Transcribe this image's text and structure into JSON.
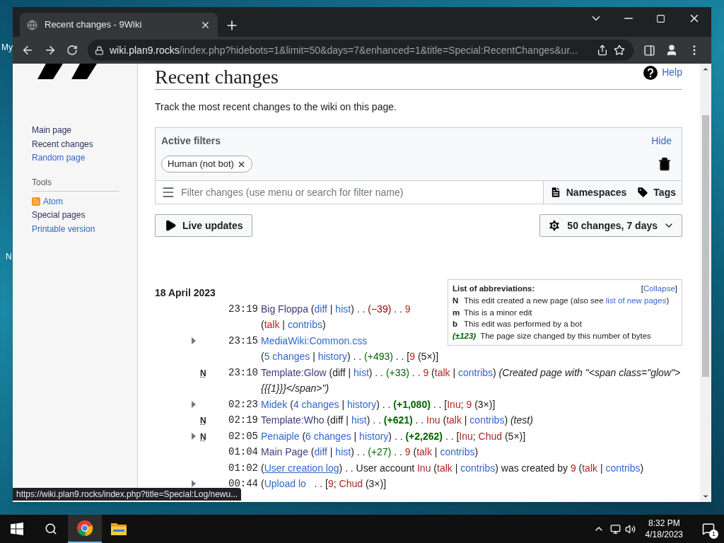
{
  "desktop": {
    "labels": [
      "My",
      "N"
    ]
  },
  "browser": {
    "tab": {
      "title": "Recent changes - 9Wiki"
    },
    "url": {
      "host": "wiki.plan9.rocks",
      "path": "/index.php?hidebots=1&limit=50&days=7&enhanced=1&title=Special:RecentChanges&ur..."
    }
  },
  "sidebar": {
    "nav": [
      {
        "label": "Main page",
        "visited": true
      },
      {
        "label": "Recent changes",
        "visited": true
      },
      {
        "label": "Random page",
        "visited": false
      }
    ],
    "tools_heading": "Tools",
    "tools": [
      {
        "label": "Atom",
        "visited": false,
        "kind": "feed"
      },
      {
        "label": "Special pages",
        "visited": true,
        "kind": "link"
      },
      {
        "label": "Printable version",
        "visited": false,
        "kind": "link"
      }
    ]
  },
  "page": {
    "title": "Recent changes",
    "help": "Help",
    "intro": "Track the most recent changes to the wiki on this page.",
    "filters": {
      "heading": "Active filters",
      "hide": "Hide",
      "tags": [
        {
          "label": "Human (not bot)"
        }
      ],
      "search_placeholder": "Filter changes (use menu or search for filter name)",
      "namespaces": "Namespaces",
      "tags_button": "Tags"
    },
    "live_updates": "Live updates",
    "options": "50 changes, 7 days"
  },
  "abbreviations": {
    "title": "List of abbreviations:",
    "collapse": {
      "open": "[",
      "label": "Collapse",
      "close": "]"
    },
    "items": [
      {
        "key": "N",
        "kind": "text",
        "parts": [
          {
            "text": "This edit created a new page (also see ",
            "kind": "text"
          },
          {
            "text": "list of new pages",
            "kind": "link"
          },
          {
            "text": ")",
            "kind": "text"
          }
        ]
      },
      {
        "key": "m",
        "kind": "text",
        "parts": [
          {
            "text": "This is a minor edit",
            "kind": "text"
          }
        ]
      },
      {
        "key": "b",
        "kind": "text",
        "parts": [
          {
            "text": "This edit was performed by a bot",
            "kind": "text"
          }
        ]
      },
      {
        "key": "(±123)",
        "kind": "size",
        "parts": [
          {
            "text": "The page size changed by this number of bytes",
            "kind": "text"
          }
        ]
      }
    ]
  },
  "changes": {
    "date": "18 April 2023",
    "rows": [
      {
        "time": "23:19",
        "expandable": false,
        "segments": [
          {
            "text": "Big Floppa",
            "kind": "visited"
          },
          {
            "kind": "group",
            "parts": [
              {
                "text": " (",
                "kind": "text"
              },
              {
                "text": "diff",
                "kind": "link"
              },
              {
                "text": " | ",
                "kind": "text"
              },
              {
                "text": "hist",
                "kind": "link"
              },
              {
                "text": ")",
                "kind": "text"
              }
            ]
          },
          {
            "text": " . . ",
            "kind": "text"
          },
          {
            "text": "(−39)",
            "kind": "neg"
          },
          {
            "text": " . . ",
            "kind": "text"
          },
          {
            "text": "9",
            "kind": "red"
          },
          {
            "kind": "group",
            "parts": [
              {
                "text": " (",
                "kind": "text"
              },
              {
                "text": "talk",
                "kind": "red"
              },
              {
                "text": " | ",
                "kind": "text"
              },
              {
                "text": "contribs",
                "kind": "link"
              },
              {
                "text": ")",
                "kind": "text"
              }
            ]
          }
        ]
      },
      {
        "time": "23:15",
        "expandable": true,
        "segments": [
          {
            "text": "MediaWiki:Common.css",
            "kind": "link"
          },
          {
            "kind": "group",
            "parts": [
              {
                "text": " (",
                "kind": "text"
              },
              {
                "text": "5 changes",
                "kind": "link"
              },
              {
                "text": " | ",
                "kind": "text"
              },
              {
                "text": "history",
                "kind": "link"
              },
              {
                "text": ") . . ",
                "kind": "text"
              },
              {
                "text": "(+493)",
                "kind": "pos"
              },
              {
                "text": " . . [",
                "kind": "text"
              },
              {
                "text": "9",
                "kind": "red"
              },
              {
                "text": " (5×)]",
                "kind": "text"
              }
            ]
          }
        ]
      },
      {
        "time": "23:10",
        "expandable": false,
        "flag": "N",
        "segments": [
          {
            "text": "Template:Glow",
            "kind": "visited"
          },
          {
            "text": " (diff | ",
            "kind": "text"
          },
          {
            "text": "hist",
            "kind": "link"
          },
          {
            "text": ") . . ",
            "kind": "text"
          },
          {
            "text": "(+33)",
            "kind": "pos"
          },
          {
            "text": " . . ",
            "kind": "text"
          },
          {
            "text": "9",
            "kind": "red"
          },
          {
            "text": " (",
            "kind": "text"
          },
          {
            "text": "talk",
            "kind": "red"
          },
          {
            "text": " | ",
            "kind": "text"
          },
          {
            "text": "contribs",
            "kind": "link"
          },
          {
            "text": ") ",
            "kind": "text"
          },
          {
            "text": "(Created page with \"<span class=\"glow\"> {{{1}}}</span>\")",
            "kind": "summary"
          }
        ]
      },
      {
        "time": "02:23",
        "expandable": true,
        "segments": [
          {
            "text": "Midek",
            "kind": "link"
          },
          {
            "text": " (",
            "kind": "text"
          },
          {
            "text": "4 changes",
            "kind": "link"
          },
          {
            "text": " | ",
            "kind": "text"
          },
          {
            "text": "history",
            "kind": "link"
          },
          {
            "text": ") . . ",
            "kind": "text"
          },
          {
            "text": "(+1,080)",
            "kind": "bigpos"
          },
          {
            "text": " . . [",
            "kind": "text"
          },
          {
            "text": "Inu",
            "kind": "red"
          },
          {
            "text": "; ",
            "kind": "text"
          },
          {
            "text": "9",
            "kind": "red"
          },
          {
            "text": " (3×)]",
            "kind": "text"
          }
        ]
      },
      {
        "time": "02:19",
        "expandable": false,
        "flag": "N",
        "segments": [
          {
            "text": "Template:Who",
            "kind": "visited"
          },
          {
            "text": " (diff | ",
            "kind": "text"
          },
          {
            "text": "hist",
            "kind": "link"
          },
          {
            "text": ") . . ",
            "kind": "text"
          },
          {
            "text": "(+621)",
            "kind": "bigpos"
          },
          {
            "text": " . . ",
            "kind": "text"
          },
          {
            "text": "Inu",
            "kind": "red"
          },
          {
            "text": " (",
            "kind": "text"
          },
          {
            "text": "talk",
            "kind": "red"
          },
          {
            "text": " | ",
            "kind": "text"
          },
          {
            "text": "contribs",
            "kind": "link"
          },
          {
            "text": ") ",
            "kind": "text"
          },
          {
            "text": "(test)",
            "kind": "summary"
          }
        ]
      },
      {
        "time": "02:05",
        "expandable": true,
        "flag": "N",
        "segments": [
          {
            "text": "Penaiple",
            "kind": "link"
          },
          {
            "text": " (",
            "kind": "text"
          },
          {
            "text": "6 changes",
            "kind": "link"
          },
          {
            "text": " | ",
            "kind": "text"
          },
          {
            "text": "history",
            "kind": "link"
          },
          {
            "text": ") . . ",
            "kind": "text"
          },
          {
            "text": "(+2,262)",
            "kind": "bigpos"
          },
          {
            "text": " . . [",
            "kind": "text"
          },
          {
            "text": "Inu",
            "kind": "red"
          },
          {
            "text": "; ",
            "kind": "text"
          },
          {
            "text": "Chud",
            "kind": "red"
          },
          {
            "text": " (5×)]",
            "kind": "text"
          }
        ]
      },
      {
        "time": "01:04",
        "expandable": false,
        "segments": [
          {
            "text": "Main Page",
            "kind": "visited"
          },
          {
            "text": " (",
            "kind": "text"
          },
          {
            "text": "diff",
            "kind": "link"
          },
          {
            "text": " | ",
            "kind": "text"
          },
          {
            "text": "hist",
            "kind": "link"
          },
          {
            "text": ") . . ",
            "kind": "text"
          },
          {
            "text": "(+27)",
            "kind": "pos"
          },
          {
            "text": " . . ",
            "kind": "text"
          },
          {
            "text": "9",
            "kind": "red"
          },
          {
            "text": " (",
            "kind": "text"
          },
          {
            "text": "talk",
            "kind": "red"
          },
          {
            "text": " | ",
            "kind": "text"
          },
          {
            "text": "contribs",
            "kind": "link"
          },
          {
            "text": ")",
            "kind": "text"
          }
        ]
      },
      {
        "time": "01:02",
        "expandable": false,
        "segments": [
          {
            "text": "(",
            "kind": "text"
          },
          {
            "text": "User creation log",
            "kind": "hover"
          },
          {
            "text": ") . . User account ",
            "kind": "text"
          },
          {
            "text": "Inu",
            "kind": "red"
          },
          {
            "text": " (",
            "kind": "text"
          },
          {
            "text": "talk",
            "kind": "red"
          },
          {
            "text": " | ",
            "kind": "text"
          },
          {
            "text": "contribs",
            "kind": "link"
          },
          {
            "text": ") was created by ",
            "kind": "text"
          },
          {
            "text": "9",
            "kind": "red"
          },
          {
            "text": " (",
            "kind": "text"
          },
          {
            "text": "talk",
            "kind": "red"
          },
          {
            "text": " | ",
            "kind": "text"
          },
          {
            "text": "contribs",
            "kind": "link"
          },
          {
            "text": ")",
            "kind": "text"
          }
        ]
      },
      {
        "time": "00:44",
        "expandable": true,
        "segments": [
          {
            "text": "(",
            "kind": "text"
          },
          {
            "text": "Upload lo",
            "kind": "link"
          },
          {
            "text": "   . . [",
            "kind": "text"
          },
          {
            "text": "9",
            "kind": "red"
          },
          {
            "text": "; ",
            "kind": "text"
          },
          {
            "text": "Chud",
            "kind": "red"
          },
          {
            "text": " (3×)]",
            "kind": "text"
          }
        ]
      }
    ]
  },
  "status_url": "https://wiki.plan9.rocks/index.php?title=Special:Log/newu...",
  "taskbar": {
    "apps": [
      {
        "kind": "chrome",
        "selected": true
      },
      {
        "kind": "explorer",
        "selected": false
      }
    ],
    "time": "8:32 PM",
    "date": "4/18/2023",
    "notifications": "1"
  }
}
